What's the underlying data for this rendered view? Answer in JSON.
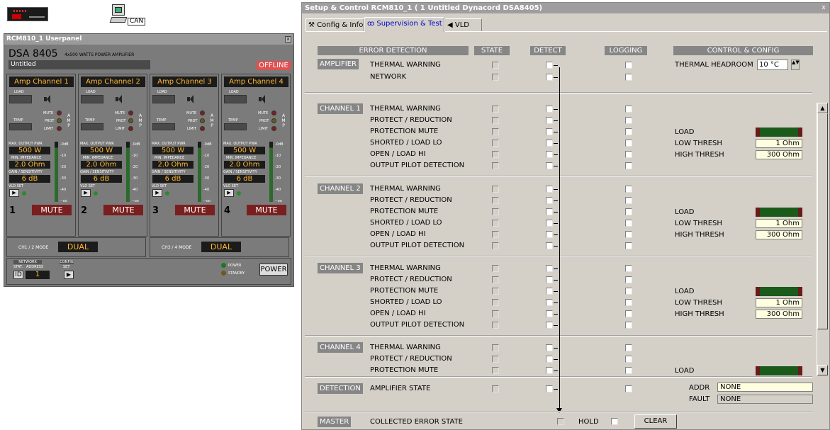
{
  "devices": {
    "can_label": "CAN"
  },
  "userpanel": {
    "title": "RCM810_1 Userpanel",
    "close": "x",
    "model": "DSA 8405",
    "model_desc": "4x500 WATTS POWER AMPLIFIER",
    "name": "Untitled",
    "status": "OFFLINE",
    "labels": {
      "load": "LOAD",
      "temp": "TEMP",
      "mute": "MUTE",
      "prot": "PROT",
      "limit": "LIMIT",
      "amp": [
        "A",
        "M",
        "P"
      ],
      "max_output": "MAX. OUTPUT PWR",
      "min_impedance": "MIN. IMPEDANCE",
      "gain": "GAIN / SENSITIVITY",
      "vld_set": "VLD SET",
      "scale": [
        "-0dB",
        "-10",
        "-20",
        "-30",
        "-40",
        "--oo"
      ],
      "mute_btn": "MUTE"
    },
    "channels": [
      {
        "name": "Amp Channel 1",
        "num": "1",
        "power": "500 W",
        "impedance": "2.0 Ohm",
        "gain": "6 dB"
      },
      {
        "name": "Amp Channel 2",
        "num": "2",
        "power": "500 W",
        "impedance": "2.0 Ohm",
        "gain": "6 dB"
      },
      {
        "name": "Amp Channel 3",
        "num": "3",
        "power": "500 W",
        "impedance": "2.0 Ohm",
        "gain": "6 dB"
      },
      {
        "name": "Amp Channel 4",
        "num": "4",
        "power": "500 W",
        "impedance": "2.0 Ohm",
        "gain": "6 dB"
      }
    ],
    "modes": [
      {
        "label": "CH1 / 2 MODE",
        "value": "DUAL"
      },
      {
        "label": "CH3 / 4 MODE",
        "value": "DUAL"
      }
    ],
    "bottom": {
      "network": "NETWORK",
      "config": "CONFIG",
      "stat": "STAT.",
      "address": "ADDRESS",
      "set": "SET",
      "id": "ID",
      "address_val": "1",
      "power_led": "POWER",
      "standby_led": "STANDBY",
      "power_btn": "POWER"
    }
  },
  "dialog": {
    "title": "Setup & Control RCM810_1 ( 1 Untitled Dynacord DSA8405)",
    "close": "x",
    "tabs": [
      "Config & Info",
      "Supervision & Test",
      "VLD"
    ],
    "headers": {
      "error": "ERROR DETECTION",
      "state": "STATE",
      "detect": "DETECT",
      "logging": "LOGGING",
      "control": "CONTROL & CONFIG"
    },
    "amplifier": {
      "label": "AMPLIFIER",
      "rows": [
        "THERMAL WARNING",
        "NETWORK"
      ]
    },
    "thermal_headroom": {
      "label": "THERMAL HEADROOM",
      "value": "10 °C"
    },
    "channel_rows": [
      "THERMAL WARNING",
      "PROTECT / REDUCTION",
      "PROTECTION MUTE",
      "SHORTED / LOAD LO",
      "OPEN / LOAD HI",
      "OUTPUT PILOT DETECTION"
    ],
    "channels": [
      {
        "label": "CHANNEL 1"
      },
      {
        "label": "CHANNEL 2"
      },
      {
        "label": "CHANNEL 3"
      },
      {
        "label": "CHANNEL 4"
      }
    ],
    "config": {
      "load": "LOAD",
      "low": "LOW THRESH",
      "high": "HIGH THRESH",
      "low_val": "1 Ohm",
      "high_val": "300 Ohm"
    },
    "detection": {
      "label": "DETECTION",
      "row": "AMPLIFIER STATE",
      "addr": "ADDR",
      "addr_val": "NONE",
      "fault": "FAULT",
      "fault_val": "NONE"
    },
    "master": {
      "label": "MASTER",
      "row": "COLLECTED ERROR STATE",
      "hold": "HOLD",
      "clear": "CLEAR"
    }
  }
}
